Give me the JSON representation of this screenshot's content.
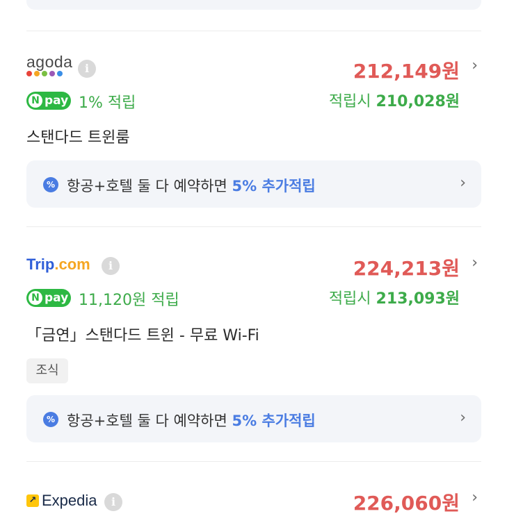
{
  "listings": [
    {
      "provider": "agoda",
      "dot_colors": [
        "#e8433a",
        "#f5a623",
        "#7bc043",
        "#9b59b6",
        "#3a8ee6"
      ],
      "price": "212,149원",
      "npay_label": "pay",
      "npay_n": "N",
      "reward": "1% 적립",
      "reward_after_label": "적립시",
      "reward_after_price": "210,028원",
      "room": "스탠다드 트윈룸",
      "promo": {
        "badge": "%",
        "text": "항공+호텔 둘 다 예약하면 ",
        "highlight": "5% 추가적립"
      }
    },
    {
      "provider_main": "Trip",
      "provider_dot": ".com",
      "price": "224,213원",
      "npay_label": "pay",
      "npay_n": "N",
      "reward": "11,120원 적립",
      "reward_after_label": "적립시",
      "reward_after_price": "213,093원",
      "room": "「금연」스탠다드 트윈 - 무료 Wi-Fi",
      "tag": "조식",
      "promo": {
        "badge": "%",
        "text": "항공+호텔 둘 다 예약하면 ",
        "highlight": "5% 추가적립"
      }
    },
    {
      "provider": "Expedia",
      "price": "226,060원"
    }
  ],
  "icons": {
    "info": "i",
    "chevron": "›",
    "expedia_arrow": "↗"
  },
  "colors": {
    "price": "#e05a57",
    "green": "#3dab4a",
    "blue_accent": "#4a7ce2",
    "npay": "#2db843"
  }
}
